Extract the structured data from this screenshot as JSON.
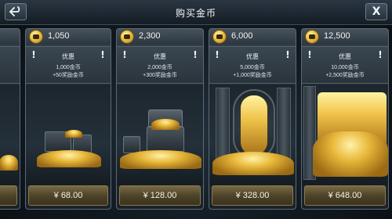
{
  "header": {
    "title": "购买金币",
    "back_icon": "back-arrow-icon",
    "close_label": "X"
  },
  "packs": [
    {
      "amount": "",
      "discount_label": "",
      "line1": "",
      "line2": "",
      "price": ""
    },
    {
      "amount": "1,050",
      "discount_label": "优惠",
      "line1": "1,000金币",
      "line2": "+50奖励金币",
      "price": "¥ 68.00"
    },
    {
      "amount": "2,300",
      "discount_label": "优惠",
      "line1": "2,000金币",
      "line2": "+300奖励金币",
      "price": "¥ 128.00"
    },
    {
      "amount": "6,000",
      "discount_label": "优惠",
      "line1": "5,000金币",
      "line2": "+1,000奖励金币",
      "price": "¥ 328.00"
    },
    {
      "amount": "12,500",
      "discount_label": "优惠",
      "line1": "10,000金币",
      "line2": "+2,500奖励金币",
      "price": "¥ 648.00"
    }
  ],
  "colors": {
    "accent_gold": "#e8b83a",
    "panel": "#283139",
    "price_button": "#4e4429"
  }
}
